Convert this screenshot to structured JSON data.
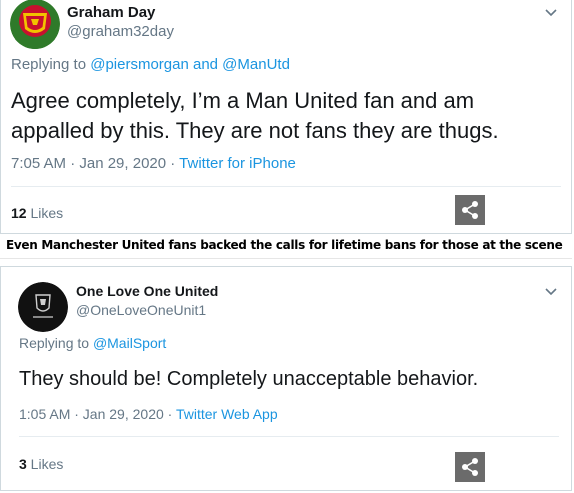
{
  "tweets": [
    {
      "name": "Graham Day",
      "handle": "@graham32day",
      "replying_prefix": "Replying to",
      "replying_to": "@piersmorgan and @ManUtd",
      "text_line1": "Agree completely, I’m a Man United fan and am",
      "text_line2": "appalled by this. They are not fans they are thugs.",
      "time": "7:05 AM · Jan 29, 2020 · ",
      "source": "Twitter for iPhone",
      "likes_count": "12",
      "likes_label": " Likes",
      "avatar_icon": "manchester-united-crest"
    },
    {
      "name": "One Love One United",
      "handle": "@OneLoveOneUnit1",
      "replying_prefix": "Replying to",
      "replying_to": "@MailSport",
      "text_line1": "They should be! Completely unacceptable behavior.",
      "time": "1:05 AM · Jan 29, 2020 · ",
      "source": "Twitter Web App",
      "likes_count": "3",
      "likes_label": " Likes",
      "avatar_icon": "black-crest-avatar"
    }
  ],
  "caption": "Even Manchester United fans backed the calls for lifetime bans for those at the scene",
  "colors": {
    "link": "#1b95e0",
    "muted": "#657786",
    "share_bg": "#6b6b6b"
  }
}
